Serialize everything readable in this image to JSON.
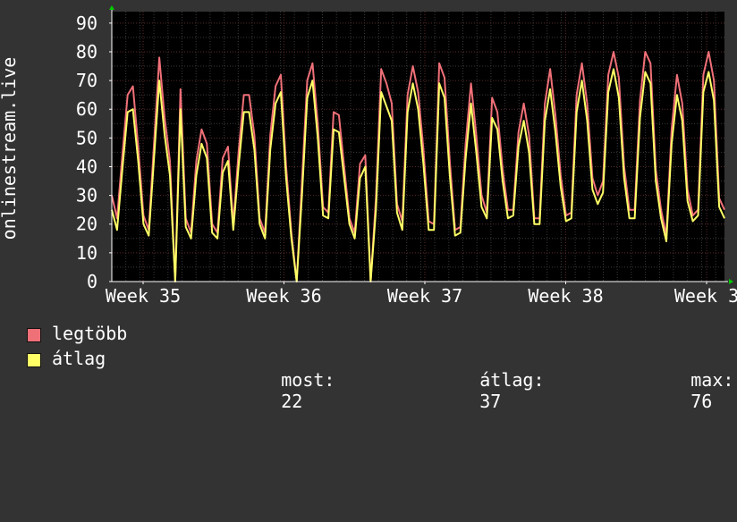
{
  "chart_data": {
    "type": "line",
    "title": "",
    "ylabel": "onlinestream.live",
    "xlabel": "",
    "ylim": [
      0,
      94
    ],
    "yticks": [
      0,
      10,
      20,
      30,
      40,
      50,
      60,
      70,
      80,
      90
    ],
    "xticks": [
      "Week 35",
      "Week 36",
      "Week 37",
      "Week 38",
      "Week 3"
    ],
    "grid": true,
    "colors": {
      "background": "#000000",
      "page": "#333333",
      "grid": "#5a2a2a",
      "axis": "#ffffff",
      "arrow": "#00cc00"
    },
    "series": [
      {
        "name": "legtöbb",
        "color": "#f07078",
        "values": [
          30,
          22,
          44,
          65,
          68,
          47,
          23,
          18,
          48,
          78,
          57,
          42,
          0,
          67,
          22,
          17,
          42,
          53,
          48,
          20,
          17,
          43,
          47,
          20,
          45,
          65,
          65,
          51,
          22,
          17,
          51,
          68,
          72,
          40,
          17,
          0,
          35,
          70,
          76,
          55,
          26,
          24,
          59,
          58,
          40,
          22,
          17,
          41,
          44,
          0,
          29,
          74,
          69,
          62,
          27,
          21,
          65,
          75,
          66,
          46,
          21,
          20,
          76,
          71,
          42,
          18,
          19,
          48,
          69,
          51,
          30,
          24,
          64,
          59,
          39,
          25,
          25,
          52,
          62,
          51,
          22,
          22,
          62,
          74,
          58,
          37,
          23,
          24,
          65,
          76,
          62,
          36,
          30,
          35,
          72,
          80,
          71,
          40,
          25,
          25,
          63,
          80,
          76,
          39,
          25,
          16,
          53,
          72,
          62,
          32,
          23,
          25,
          72,
          80,
          70,
          29,
          25
        ]
      },
      {
        "name": "átlag",
        "color": "#ffff66",
        "values": [
          25,
          18,
          39,
          59,
          60,
          42,
          20,
          16,
          43,
          70,
          51,
          37,
          0,
          60,
          19,
          15,
          37,
          48,
          43,
          17,
          15,
          38,
          42,
          18,
          40,
          59,
          59,
          46,
          20,
          15,
          46,
          62,
          66,
          36,
          15,
          0,
          30,
          64,
          70,
          50,
          23,
          22,
          53,
          52,
          36,
          20,
          15,
          36,
          40,
          0,
          25,
          66,
          61,
          56,
          24,
          18,
          59,
          69,
          60,
          41,
          18,
          18,
          69,
          64,
          37,
          16,
          17,
          43,
          62,
          45,
          26,
          22,
          57,
          53,
          35,
          22,
          23,
          47,
          56,
          45,
          20,
          20,
          56,
          67,
          52,
          33,
          21,
          22,
          59,
          70,
          56,
          32,
          27,
          31,
          66,
          74,
          64,
          36,
          22,
          22,
          57,
          73,
          69,
          35,
          22,
          14,
          48,
          65,
          56,
          28,
          21,
          23,
          66,
          73,
          63,
          26,
          22
        ]
      }
    ],
    "stats": [
      {
        "label": "most:",
        "value": "22"
      },
      {
        "label": "átlag:",
        "value": "37"
      },
      {
        "label": "max:",
        "value": "76"
      }
    ]
  }
}
